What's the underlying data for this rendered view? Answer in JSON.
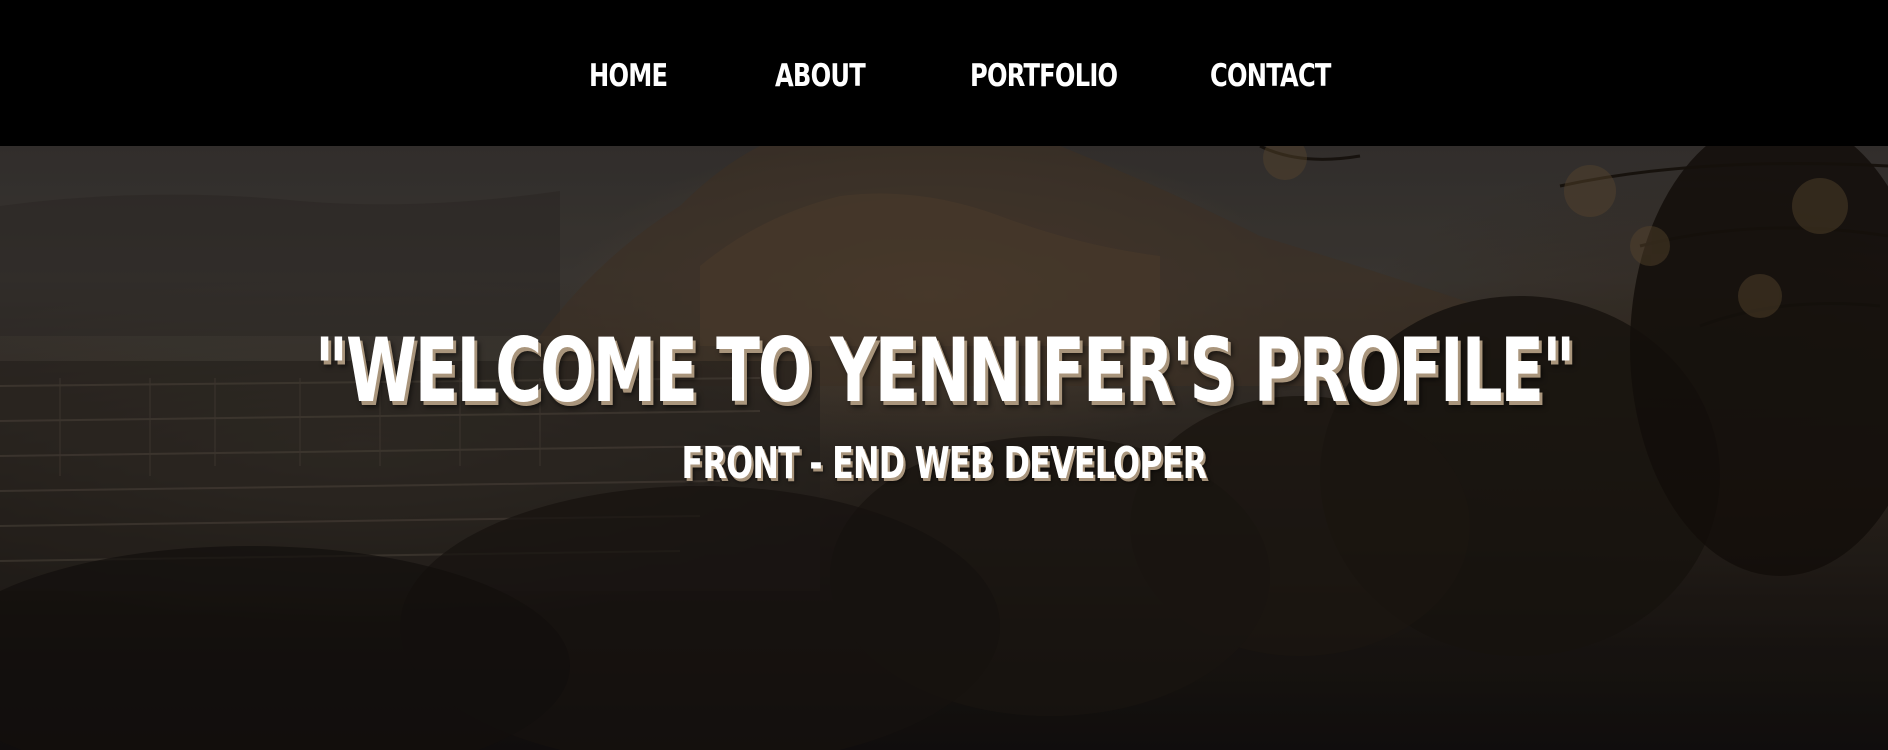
{
  "nav": {
    "items": [
      {
        "label": "HOME"
      },
      {
        "label": "ABOUT"
      },
      {
        "label": "PORTFOLIO"
      },
      {
        "label": "CONTACT"
      }
    ]
  },
  "hero": {
    "title": "\"WELCOME TO YENNIFER'S PROFILE\"",
    "subtitle": "FRONT - END WEB DEVELOPER",
    "background_image": "forest-landscape-photo"
  },
  "colors": {
    "nav_background": "#000000",
    "text": "#ffffff",
    "title_shadow": "#a9957c"
  }
}
